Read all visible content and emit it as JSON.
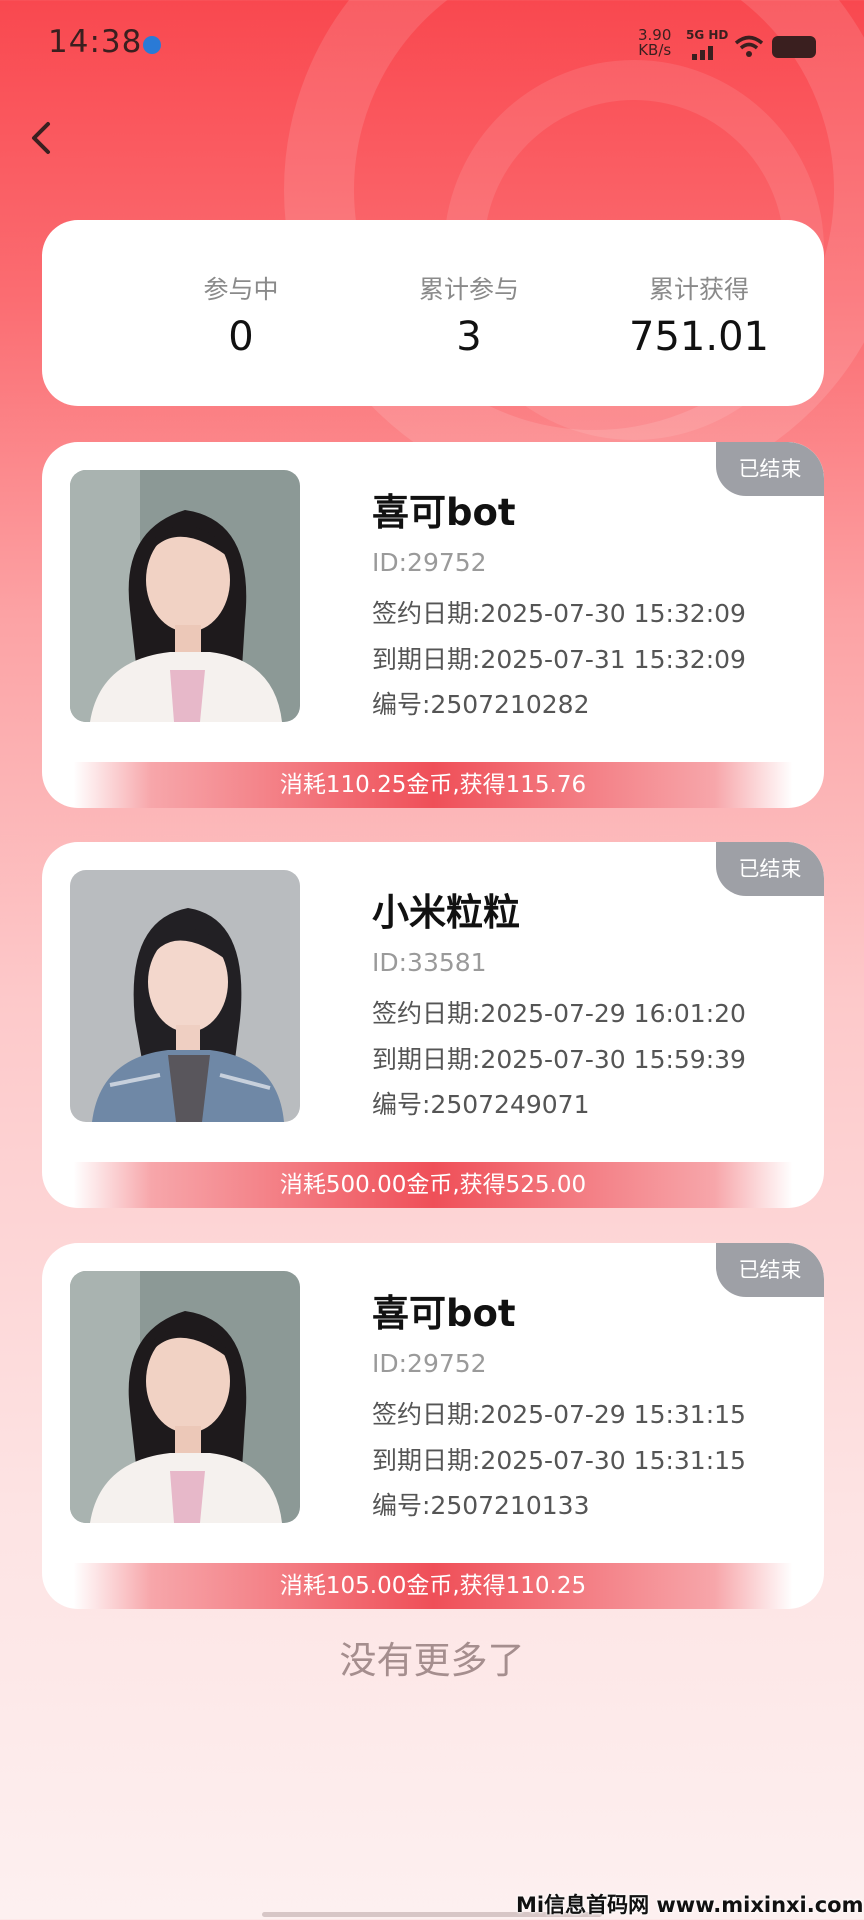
{
  "status_bar": {
    "time": "14:38",
    "net_speed": "3.90",
    "net_unit": "KB/s",
    "net_badge": "5G HD"
  },
  "summary": {
    "items": [
      {
        "label": "参与中",
        "value": "0"
      },
      {
        "label": "累计参与",
        "value": "3"
      },
      {
        "label": "累计获得",
        "value": "751.01"
      }
    ]
  },
  "records": [
    {
      "status": "已结束",
      "name": "喜可bot",
      "id": "ID:29752",
      "sign_date": "签约日期:2025-07-30 15:32:09",
      "expire_date": "到期日期:2025-07-31 15:32:09",
      "number": "编号:2507210282",
      "result": "消耗110.25金币,获得115.76"
    },
    {
      "status": "已结束",
      "name": "小米粒粒",
      "id": "ID:33581",
      "sign_date": "签约日期:2025-07-29 16:01:20",
      "expire_date": "到期日期:2025-07-30 15:59:39",
      "number": "编号:2507249071",
      "result": "消耗500.00金币,获得525.00"
    },
    {
      "status": "已结束",
      "name": "喜可bot",
      "id": "ID:29752",
      "sign_date": "签约日期:2025-07-29 15:31:15",
      "expire_date": "到期日期:2025-07-30 15:31:15",
      "number": "编号:2507210133",
      "result": "消耗105.00金币,获得110.25"
    }
  ],
  "footer": {
    "no_more": "没有更多了",
    "watermark": "Mi信息首码网 www.mixinxi.com"
  },
  "colors": {
    "accent": "#ef4f58",
    "badge": "#9ea0a6"
  },
  "icons": [
    "back-arrow-icon",
    "location-dot-icon",
    "signal-icon",
    "wifi-icon",
    "battery-icon"
  ]
}
